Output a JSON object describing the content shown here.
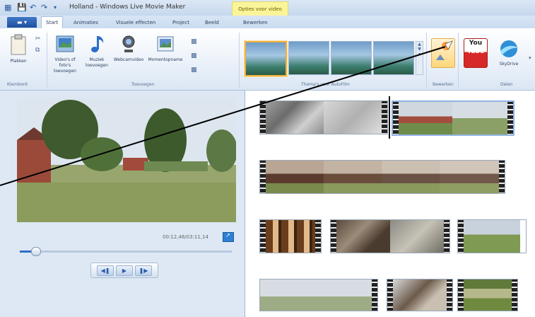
{
  "window": {
    "title": "Holland - Windows Live Movie Maker",
    "context_tab": "Opties voor video"
  },
  "tabs": {
    "file": "",
    "items": [
      "Start",
      "Animaties",
      "Visuele effecten",
      "Project",
      "Beeld",
      "Bewerken"
    ]
  },
  "ribbon": {
    "paste_label": "Plakken",
    "clipboard_group": "Klembord",
    "add_video_label": "Video's of foto's toevoegen",
    "add_music_label": "Muziek toevoegen",
    "webcam_label": "Webcamvideo",
    "snapshot_label": "Momentopname",
    "add_group": "Toevoegen",
    "themes_group": "Thema's voor AutoFilm",
    "share_group": "Delen",
    "edit_group": "Bewerken",
    "youtube_label": "You Tube",
    "skydrive_label": "SkyDrive"
  },
  "preview": {
    "timecode": "00:12,46/03:11,14"
  },
  "colors": {
    "accent": "#2f6fc3",
    "ribbon_bg": "#e6eef8",
    "panel_bg": "#dde8f4",
    "context_tab": "#fbf59a"
  }
}
